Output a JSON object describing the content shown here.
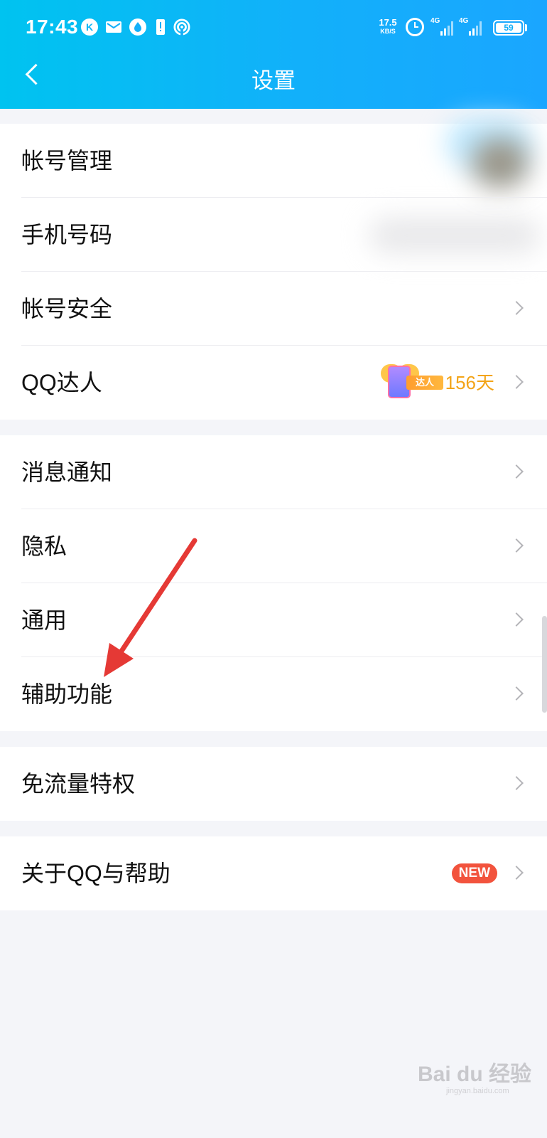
{
  "status_bar": {
    "time": "17:43",
    "icons": [
      "k-app-icon",
      "mail-icon",
      "drop-icon",
      "alert-icon",
      "hotspot-icon"
    ],
    "net_speed_value": "17.5",
    "net_speed_unit": "KB/S",
    "signal_1": "4G",
    "signal_2": "4G",
    "battery": "59"
  },
  "header": {
    "title": "设置"
  },
  "groups": [
    {
      "items": [
        {
          "label": "帐号管理"
        },
        {
          "label": "手机号码"
        },
        {
          "label": "帐号安全"
        },
        {
          "label": "QQ达人",
          "badge_text": "达人",
          "value": "156天"
        }
      ]
    },
    {
      "items": [
        {
          "label": "消息通知"
        },
        {
          "label": "隐私"
        },
        {
          "label": "通用"
        },
        {
          "label": "辅助功能"
        }
      ]
    },
    {
      "items": [
        {
          "label": "免流量特权"
        }
      ]
    },
    {
      "items": [
        {
          "label": "关于QQ与帮助",
          "badge": "NEW"
        }
      ]
    }
  ],
  "annotation_color": "#e53935",
  "accent_color": "#12b0fa",
  "watermark": {
    "brand": "Bai du 经验",
    "url": "jingyan.baidu.com"
  }
}
